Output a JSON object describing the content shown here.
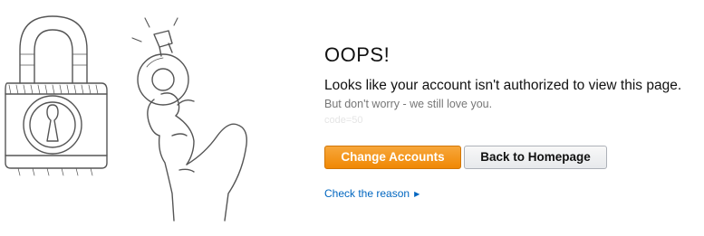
{
  "error": {
    "title": "OOPS!",
    "message": "Looks like your account isn't authorized to view this page.",
    "sub_message": "But don't worry - we still love you.",
    "code": "code=50"
  },
  "actions": {
    "change_accounts_label": "Change Accounts",
    "back_home_label": "Back to Homepage"
  },
  "link": {
    "check_reason_label": "Check the reason",
    "arrow_icon": "caret-right-icon"
  },
  "colors": {
    "primary_button": "#f08804",
    "link": "#0066c0",
    "text": "#111111",
    "muted": "#777777"
  }
}
